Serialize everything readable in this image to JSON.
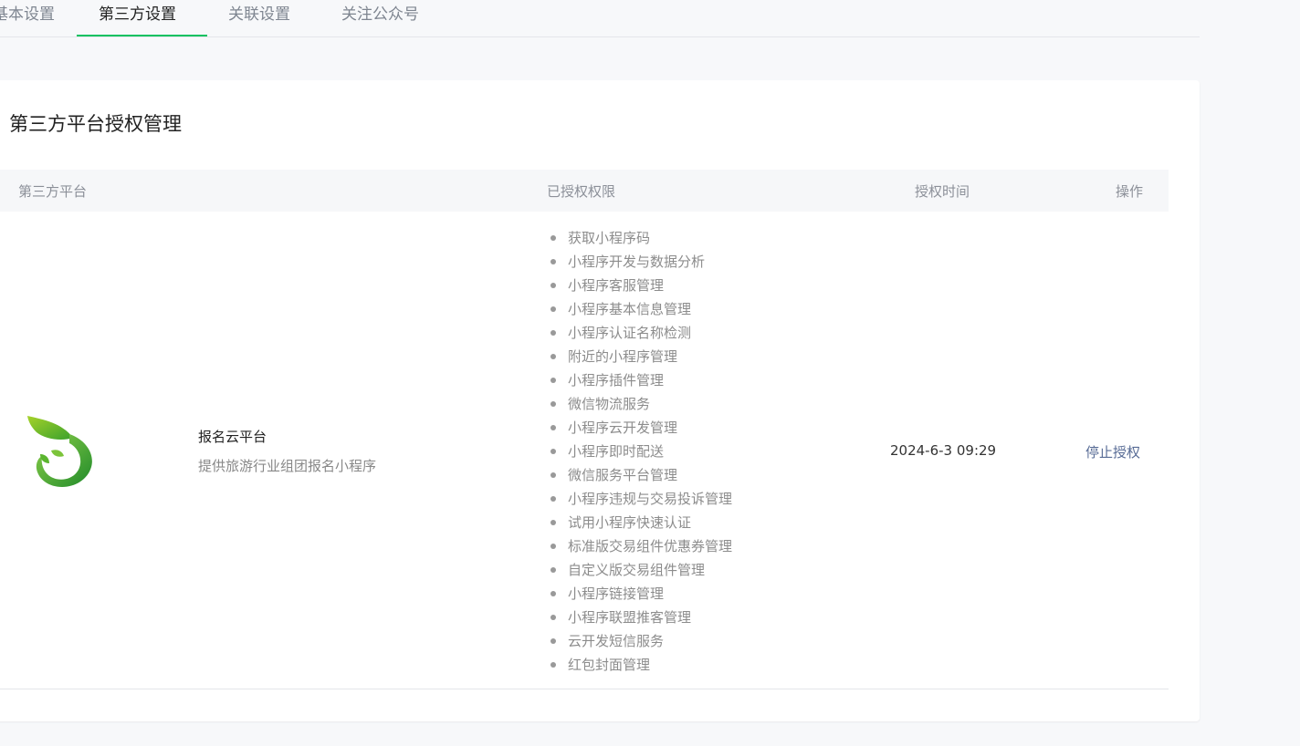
{
  "tabs": [
    {
      "label": "基本设置",
      "active": false
    },
    {
      "label": "第三方设置",
      "active": true
    },
    {
      "label": "关联设置",
      "active": false
    },
    {
      "label": "关注公众号",
      "active": false
    }
  ],
  "accent_color": "#07c160",
  "link_color": "#576b95",
  "section": {
    "title": "第三方平台授权管理"
  },
  "table": {
    "headers": {
      "platform": "第三方平台",
      "permissions": "已授权权限",
      "time": "授权时间",
      "action": "操作"
    },
    "rows": [
      {
        "logo_icon": "leaf-logo-icon",
        "name": "报名云平台",
        "description": "提供旅游行业组团报名小程序",
        "permissions": [
          "获取小程序码",
          "小程序开发与数据分析",
          "小程序客服管理",
          "小程序基本信息管理",
          "小程序认证名称检测",
          "附近的小程序管理",
          "小程序插件管理",
          "微信物流服务",
          "小程序云开发管理",
          "小程序即时配送",
          "微信服务平台管理",
          "小程序违规与交易投诉管理",
          "试用小程序快速认证",
          "标准版交易组件优惠券管理",
          "自定义版交易组件管理",
          "小程序链接管理",
          "小程序联盟推客管理",
          "云开发短信服务",
          "红包封面管理"
        ],
        "time": "2024-6-3 09:29",
        "action": "停止授权"
      }
    ]
  }
}
